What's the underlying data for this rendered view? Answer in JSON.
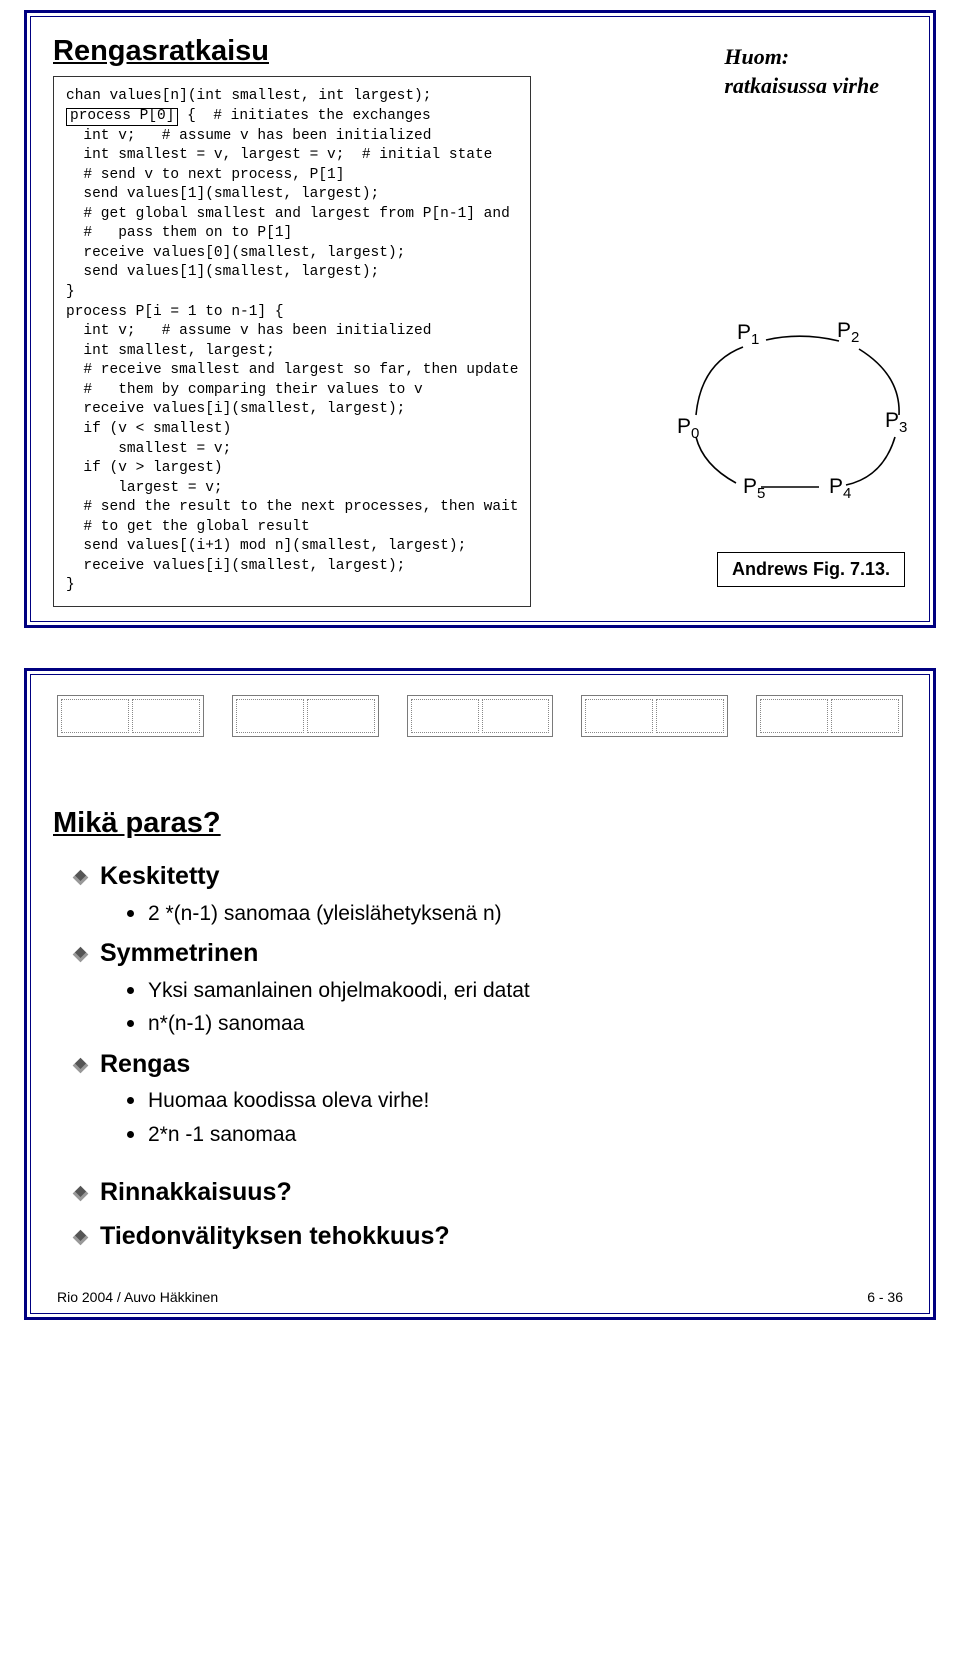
{
  "slide1": {
    "title": "Rengasratkaisu",
    "note_line1": "Huom:",
    "note_line2": "ratkaisussa virhe",
    "code_line0": "chan values[n](int smallest, int largest);",
    "code_process0": "process P[0]",
    "code_p0_rest": " {  # initiates the exchanges",
    "code_p0": "  int v;   # assume v has been initialized\n  int smallest = v, largest = v;  # initial state\n  # send v to next process, P[1]\n  send values[1](smallest, largest);\n  # get global smallest and largest from P[n-1] and\n  #   pass them on to P[1]\n  receive values[0](smallest, largest);\n  send values[1](smallest, largest);\n}",
    "code_pi": "process P[i = 1 to n-1] {\n  int v;   # assume v has been initialized\n  int smallest, largest;\n  # receive smallest and largest so far, then update\n  #   them by comparing their values to v\n  receive values[i](smallest, largest);\n  if (v < smallest)\n      smallest = v;\n  if (v > largest)\n      largest = v;\n  # send the result to the next processes, then wait\n  # to get the global result\n  send values[(i+1) mod n](smallest, largest);\n  receive values[i](smallest, largest);\n}",
    "ring": {
      "p0": "P",
      "s0": "0",
      "p1": "P",
      "s1": "1",
      "p2": "P",
      "s2": "2",
      "p3": "P",
      "s3": "3",
      "p4": "P",
      "s4": "4",
      "p5": "P",
      "s5": "5"
    },
    "andrews": "Andrews Fig. 7.13."
  },
  "slide2": {
    "title": "Mikä paras?",
    "b1a": "Keskitetty",
    "b1a_sub1": "2 *(n-1) sanomaa (yleislähetyksenä n)",
    "b1b": "Symmetrinen",
    "b1b_sub1": "Yksi samanlainen ohjelmakoodi, eri datat",
    "b1b_sub2": "n*(n-1) sanomaa",
    "b1c": "Rengas",
    "b1c_sub1": "Huomaa koodissa oleva virhe!",
    "b1c_sub2": "2*n -1 sanomaa",
    "b1d": "Rinnakkaisuus?",
    "b1e": "Tiedonvälityksen tehokkuus?",
    "footer_left": "Rio 2004 / Auvo Häkkinen",
    "footer_right": "6 - 36"
  }
}
